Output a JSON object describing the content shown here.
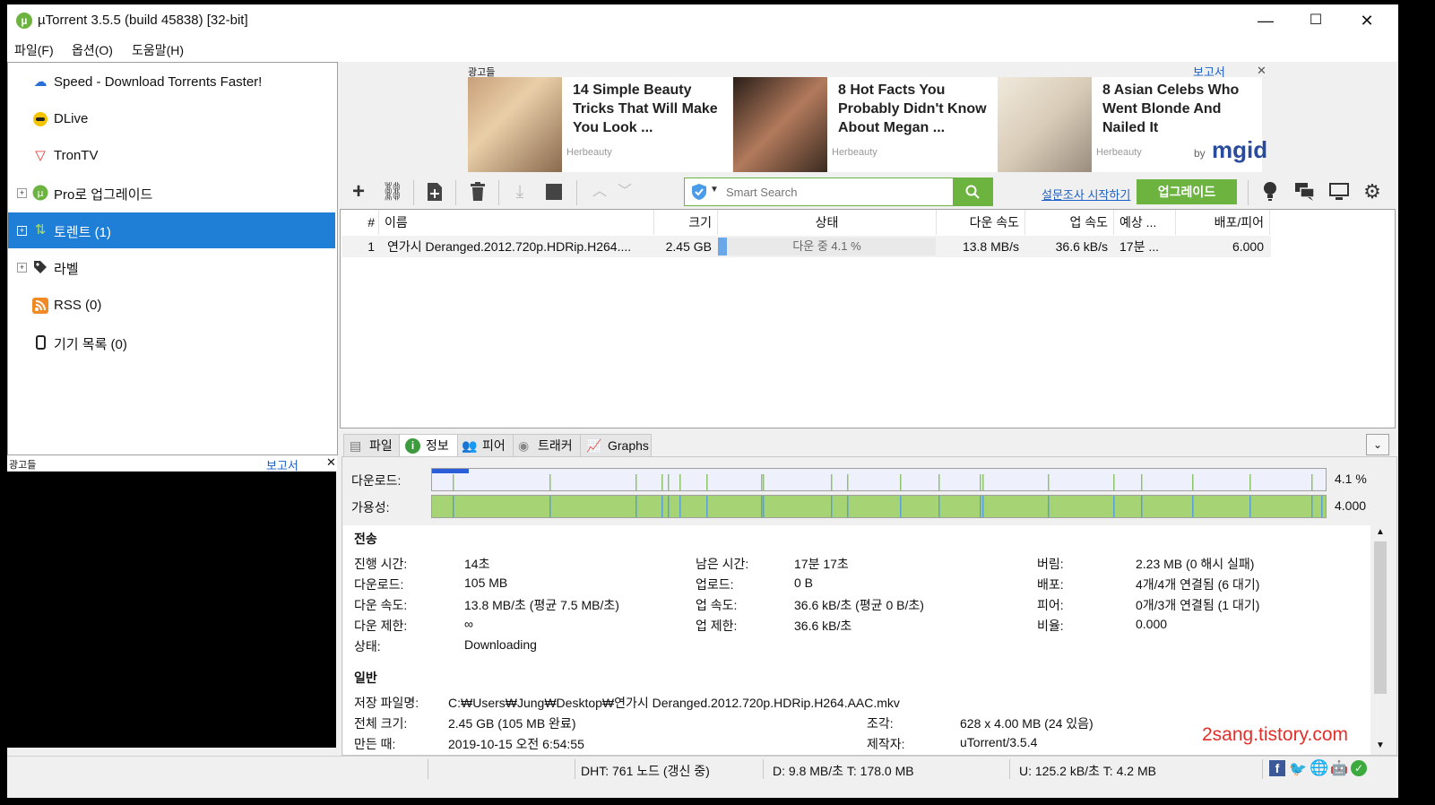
{
  "window": {
    "title": "µTorrent 3.5.5  (build 45838) [32-bit]",
    "logo": "µ",
    "controls": {
      "minimize": "—",
      "maximize": "☐",
      "close": "✕"
    }
  },
  "menu": [
    "파일(F)",
    "옵션(O)",
    "도움말(H)"
  ],
  "sidebar": {
    "items": [
      {
        "label": "Speed - Download Torrents Faster!",
        "icon": "speed-icon"
      },
      {
        "label": "DLive",
        "icon": "dlive-icon"
      },
      {
        "label": "TronTV",
        "icon": "tron-icon"
      },
      {
        "label": "Pro로 업그레이드",
        "icon": "utorrent-pro-icon"
      },
      {
        "label": "토렌트 (1)",
        "icon": "torrents-icon",
        "selected": true
      },
      {
        "label": "라벨",
        "icon": "tag-icon"
      },
      {
        "label": "RSS (0)",
        "icon": "rss-icon"
      },
      {
        "label": "기기 목록 (0)",
        "icon": "device-icon"
      }
    ],
    "ad_header": "광고들",
    "ad_report": "보고서"
  },
  "top_ad": {
    "header": "광고들",
    "report": "보고서",
    "brand": "mgid",
    "brand_prefix": "by",
    "cards": [
      {
        "text": "14 Simple Beauty Tricks That Will Make You Look ...",
        "source": "Herbeauty"
      },
      {
        "text": "8 Hot Facts You Probably Didn't Know About Megan ...",
        "source": "Herbeauty"
      },
      {
        "text": "8 Asian Celebs Who Went Blonde And Nailed It",
        "source": "Herbeauty"
      }
    ]
  },
  "toolbar": {
    "search_placeholder": "Smart Search",
    "survey_link": "설문조사 시작하기",
    "upgrade_label": "업그레이드"
  },
  "torrent_list": {
    "columns": [
      "#",
      "이름",
      "크기",
      "상태",
      "다운 속도",
      "업 속도",
      "예상 ...",
      "배포/피어"
    ],
    "rows": [
      {
        "num": "1",
        "name": "연가시 Deranged.2012.720p.HDRip.H264....",
        "size": "2.45 GB",
        "status": "다운 중 4.1 %",
        "progress": 0.041,
        "down": "13.8 MB/s",
        "up": "36.6 kB/s",
        "eta": "17분 ...",
        "ratio": "6.000"
      }
    ]
  },
  "tabs": [
    "파일",
    "정보",
    "피어",
    "트래커",
    "Graphs"
  ],
  "bars": {
    "download_label": "다운로드:",
    "download_value": "4.1 %",
    "download_fraction": 0.041,
    "availability_label": "가용성:",
    "availability_value": "4.000"
  },
  "info": {
    "transfer_heading": "전송",
    "col1": [
      [
        "진행 시간:",
        "14초"
      ],
      [
        "다운로드:",
        "105 MB"
      ],
      [
        "다운 속도:",
        "13.8 MB/초 (평균 7.5 MB/초)"
      ],
      [
        "다운 제한:",
        "∞"
      ],
      [
        "상태:",
        "Downloading"
      ]
    ],
    "col2": [
      [
        "남은 시간:",
        "17분 17초"
      ],
      [
        "업로드:",
        "0 B"
      ],
      [
        "업 속도:",
        "36.6 kB/초 (평균 0 B/초)"
      ],
      [
        "업 제한:",
        "36.6 kB/초"
      ]
    ],
    "col3": [
      [
        "버림:",
        "2.23 MB (0 해시 실패)"
      ],
      [
        "배포:",
        "4개/4개 연결됨 (6 대기)"
      ],
      [
        "피어:",
        "0개/3개 연결됨 (1 대기)"
      ],
      [
        "비율:",
        "0.000"
      ]
    ],
    "general_heading": "일반",
    "general": [
      [
        "저장 파일명:",
        "C:₩Users₩Jung₩Desktop₩연가시 Deranged.2012.720p.HDRip.H264.AAC.mkv"
      ],
      [
        "전체 크기:",
        "2.45 GB (105 MB 완료)"
      ],
      [
        "만든 때:",
        "2019-10-15 오전 6:54:55"
      ]
    ],
    "general_right": [
      [
        "조각:",
        "628 x 4.00 MB (24 있음)"
      ],
      [
        "제작자:",
        "uTorrent/3.5.4"
      ]
    ],
    "watermark": "2sang.tistory.com"
  },
  "status_bar": {
    "dht": "DHT: 761 노드  (갱신 중)",
    "down": "D: 9.8 MB/초 T: 178.0 MB",
    "up": "U: 125.2 kB/초 T: 4.2 MB"
  },
  "colors": {
    "accent": "#6db33f",
    "selection": "#1f7ed6",
    "availability": "#a6d373",
    "progress": "#2b5fd9"
  }
}
